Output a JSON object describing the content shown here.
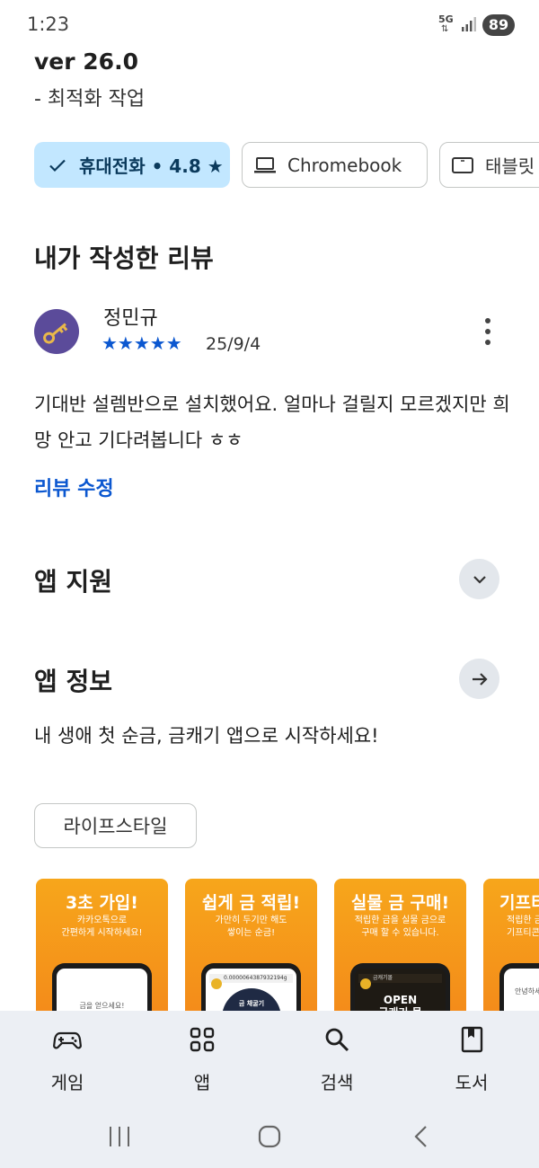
{
  "status_bar": {
    "time": "1:23",
    "network": "5G",
    "battery": "89"
  },
  "version": {
    "title": "ver 26.0",
    "note": "- 최적화 작업"
  },
  "device_chips": [
    {
      "label": "휴대전화 • 4.8 ★",
      "selected": true
    },
    {
      "label": "Chromebook",
      "selected": false
    },
    {
      "label": "태블릿",
      "selected": false
    }
  ],
  "my_review": {
    "section_title": "내가 작성한 리뷰",
    "reviewer": "정민규",
    "stars": "★★★★★",
    "rating": 5,
    "date": "25/9/4",
    "text": "기대반 설렘반으로 설치했어요. 얼마나 걸릴지 모르겠지만 희망 안고 기다려봅니다 ㅎㅎ",
    "edit_label": "리뷰 수정"
  },
  "app_support": {
    "title": "앱 지원"
  },
  "app_info": {
    "title": "앱 정보",
    "description": "내 생애 첫 순금, 금캐기 앱으로 시작하세요!",
    "tag": "라이프스타일"
  },
  "screenshots": [
    {
      "title": "3초 가입!",
      "subtitle": "카카오톡으로\n간편하게 시작하세요!",
      "screen_text": "금을 얻으세요!"
    },
    {
      "title": "쉽게 금 적립!",
      "subtitle": "가만히 두기만 해도\n쌓이는 순금!",
      "screen_text": "0.0000064387932194g",
      "screen_label": "금 채굴기"
    },
    {
      "title": "실물 금 구매!",
      "subtitle": "적립한 금을 실물 금으로\n구매 할 수 있습니다.",
      "screen_text": "금캐기몰",
      "screen_big": "OPEN\n금캐기 몰"
    },
    {
      "title": "기프티",
      "subtitle": "적립한 금\n기프티콘",
      "screen_text": "안녕하세요 들"
    }
  ],
  "bottom_nav": [
    {
      "label": "게임",
      "icon": "gamepad-icon"
    },
    {
      "label": "앱",
      "icon": "apps-grid-icon"
    },
    {
      "label": "검색",
      "icon": "search-icon"
    },
    {
      "label": "도서",
      "icon": "book-icon"
    }
  ],
  "colors": {
    "accent": "#0b57d0",
    "chip_selected_bg": "#c2e7ff",
    "screenshot_orange": "#f7a61b",
    "nav_bg": "#eceff4"
  }
}
